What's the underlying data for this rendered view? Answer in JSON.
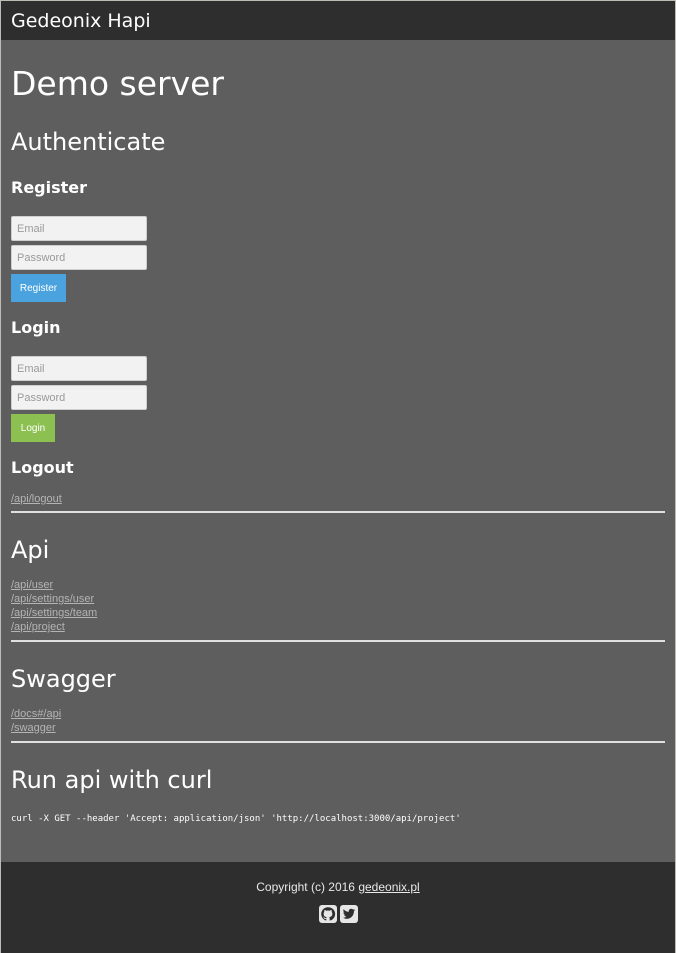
{
  "app": {
    "brand": "Gedeonix Hapi"
  },
  "page": {
    "title": "Demo server"
  },
  "auth": {
    "heading": "Authenticate",
    "register": {
      "heading": "Register",
      "email_placeholder": "Email",
      "password_placeholder": "Password",
      "button_label": "Register"
    },
    "login": {
      "heading": "Login",
      "email_placeholder": "Email",
      "password_placeholder": "Password",
      "button_label": "Login"
    },
    "logout": {
      "heading": "Logout",
      "link": "/api/logout"
    }
  },
  "api": {
    "heading": "Api",
    "links": [
      "/api/user",
      "/api/settings/user",
      "/api/settings/team",
      "/api/project"
    ]
  },
  "swagger": {
    "heading": "Swagger",
    "links": [
      "/docs#/api",
      "/swagger"
    ]
  },
  "curl": {
    "heading": "Run api with curl",
    "command": "curl -X GET --header 'Accept: application/json' 'http://localhost:3000/api/project'"
  },
  "footer": {
    "copyright": "Copyright (c) 2016",
    "site_link": "gedeonix.pl",
    "icons": [
      "github-icon",
      "twitter-icon"
    ]
  },
  "colors": {
    "background": "#5e5e5e",
    "bar": "#2e2e2e",
    "register_button": "#4aa3df",
    "login_button": "#8cc152"
  }
}
